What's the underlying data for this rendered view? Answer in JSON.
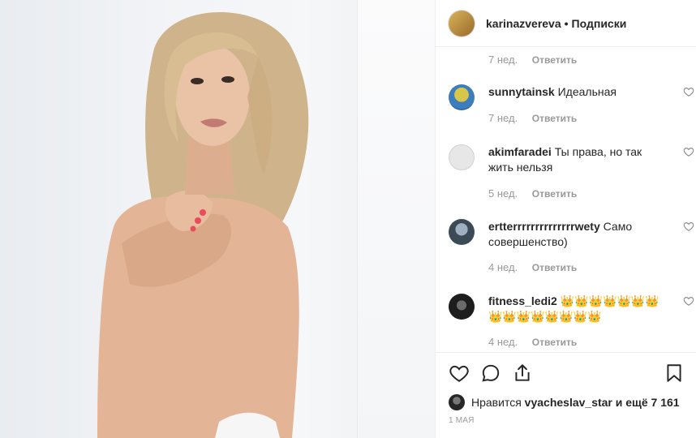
{
  "header": {
    "username": "karinazvereva",
    "separator": "•",
    "follow_label": "Подписки"
  },
  "comments_area": {
    "first_meta": {
      "time": "7 нед.",
      "reply": "Ответить"
    },
    "items": [
      {
        "username": "sunnytainsk",
        "text": "Идеальная",
        "time": "7 нед.",
        "reply": "Ответить"
      },
      {
        "username": "akimfaradei",
        "text": "Ты права, но так жить нельзя",
        "time": "5 нед.",
        "reply": "Ответить"
      },
      {
        "username": "ertterrrrrrrrrrrrrrwety",
        "text": "Само совершенство)",
        "time": "4 нед.",
        "reply": "Ответить"
      },
      {
        "username": "fitness_ledi2",
        "text": "👑👑👑👑👑👑👑👑👑👑👑👑👑👑👑",
        "time": "4 нед.",
        "reply": "Ответить"
      }
    ]
  },
  "actions": {
    "icons": [
      "heart-icon",
      "comment-icon",
      "share-icon",
      "bookmark-icon"
    ],
    "likes_prefix": "Нравится",
    "likes_user": "vyacheslav_star",
    "likes_suffix": "и ещё 7 161",
    "date": "1 мая"
  }
}
